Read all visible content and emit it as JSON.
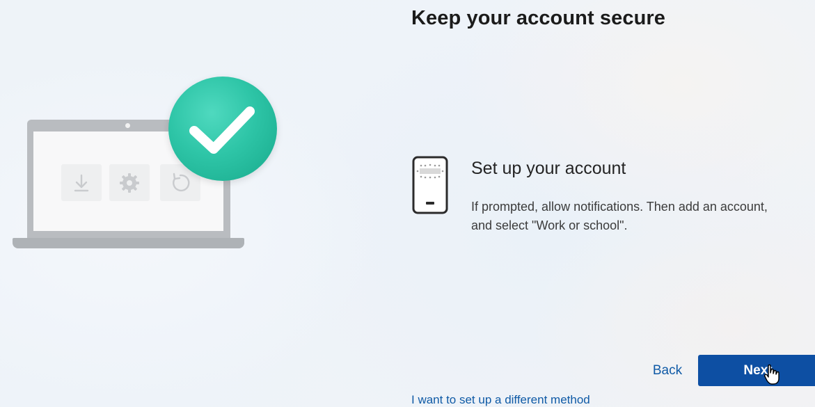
{
  "page": {
    "title": "Keep your account secure"
  },
  "step": {
    "icon": "phone-icon",
    "title": "Set up your account",
    "description": "If prompted, allow notifications. Then add an account, and select \"Work or school\"."
  },
  "illustration": {
    "icons": [
      "laptop-icon",
      "download-icon",
      "gear-icon",
      "refresh-icon",
      "checkmark-icon"
    ]
  },
  "buttons": {
    "back_label": "Back",
    "next_label": "Next"
  },
  "links": {
    "alternate_method": "I want to set up a different method"
  },
  "colors": {
    "accent": "#0d4fa3",
    "link": "#0f5aa6",
    "check_green": "#2ec5a7"
  }
}
